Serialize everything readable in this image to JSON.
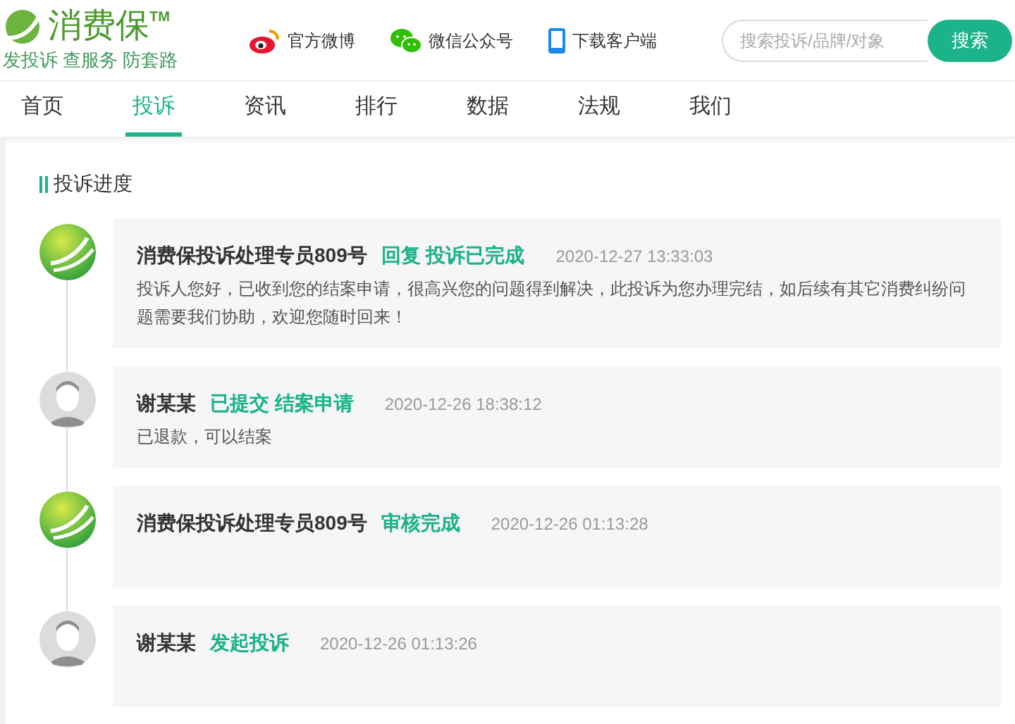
{
  "header": {
    "logo": {
      "name": "消费保",
      "mark": "TM",
      "slogan": "发投诉 查服务 防套路"
    },
    "links": [
      {
        "kind": "weibo",
        "label": "官方微博"
      },
      {
        "kind": "wechat",
        "label": "微信公众号"
      },
      {
        "kind": "phone",
        "label": "下载客户端"
      }
    ],
    "search": {
      "placeholder": "搜索投诉/品牌/对象",
      "button": "搜索"
    }
  },
  "nav": [
    {
      "label": "首页",
      "selected": false
    },
    {
      "label": "投诉",
      "selected": true
    },
    {
      "label": "资讯",
      "selected": false
    },
    {
      "label": "排行",
      "selected": false
    },
    {
      "label": "数据",
      "selected": false
    },
    {
      "label": "法规",
      "selected": false
    },
    {
      "label": "我们",
      "selected": false
    }
  ],
  "progress": {
    "title": "投诉进度",
    "entries": [
      {
        "kind": "official",
        "author": "消费保投诉处理专员809号",
        "status": "回复 投诉已完成",
        "time": "2020-12-27 13:33:03",
        "message": "投诉人您好，已收到您的结案申请，很高兴您的问题得到解决，此投诉为您办理完结，如后续有其它消费纠纷问题需要我们协助，欢迎您随时回来！"
      },
      {
        "kind": "user",
        "author": "谢某某",
        "status": "已提交 结案申请",
        "time": "2020-12-26 18:38:12",
        "message": "已退款，可以结案"
      },
      {
        "kind": "official",
        "author": "消费保投诉处理专员809号",
        "status": "审核完成",
        "time": "2020-12-26 01:13:28"
      },
      {
        "kind": "user",
        "author": "谢某某",
        "status": "发起投诉",
        "time": "2020-12-26 01:13:26"
      }
    ]
  }
}
